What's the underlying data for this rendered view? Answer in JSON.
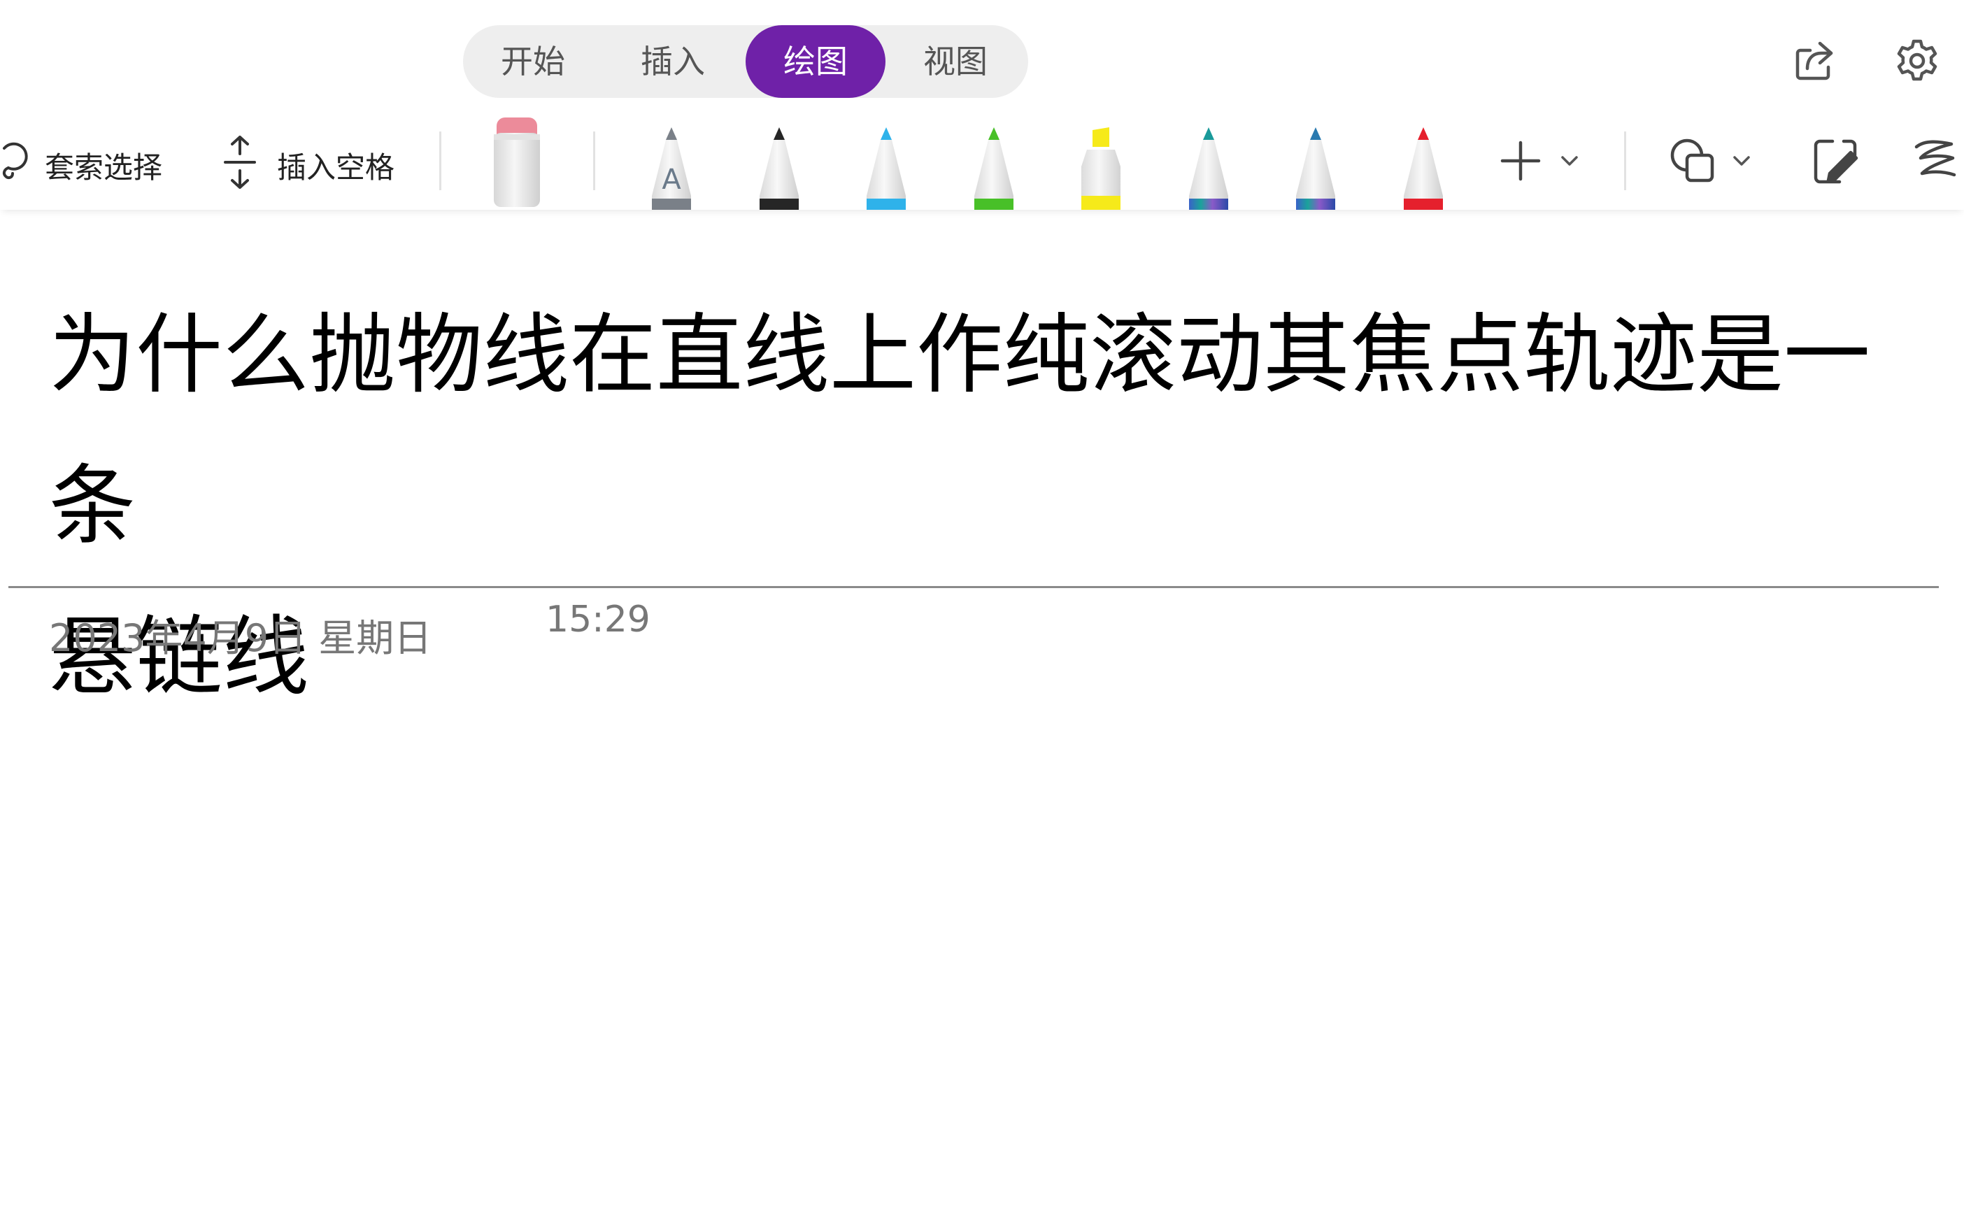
{
  "tabs": [
    {
      "label": "开始",
      "active": false
    },
    {
      "label": "插入",
      "active": false
    },
    {
      "label": "绘图",
      "active": true
    },
    {
      "label": "视图",
      "active": false
    }
  ],
  "topbar": {
    "share_icon": "share-icon",
    "settings_icon": "gear-icon"
  },
  "toolbar": {
    "lasso_label": "套索选择",
    "insert_space_label": "插入空格",
    "eraser_icon": "eraser-icon",
    "add_pen_icon": "plus-icon",
    "shapes_icon": "shapes-icon",
    "ink_to_shape_icon": "ink-to-shape-icon",
    "ink_to_text_icon": "ink-to-text-icon",
    "pens": [
      {
        "name": "text-pen",
        "color": "#7a8088",
        "letter": "A"
      },
      {
        "name": "black-pen",
        "color": "#262626"
      },
      {
        "name": "blue-pen",
        "color": "#2fb2ea"
      },
      {
        "name": "green-pen",
        "color": "#48c028"
      },
      {
        "name": "yellow-highlighter",
        "color": "#f6ea1a"
      },
      {
        "name": "galaxy-pen-teal",
        "color": "#1a9a9a"
      },
      {
        "name": "galaxy-pen-blue",
        "color": "#2a7ab0"
      },
      {
        "name": "red-pen",
        "color": "#e5202d"
      }
    ]
  },
  "accent_color": "#6f21a8",
  "page": {
    "title_line1": "为什么抛物线在直线上作纯滚动其焦点轨迹是一条",
    "title_line2": "悬链线",
    "date": "2023年4月9日  星期日",
    "time": "15:29"
  }
}
